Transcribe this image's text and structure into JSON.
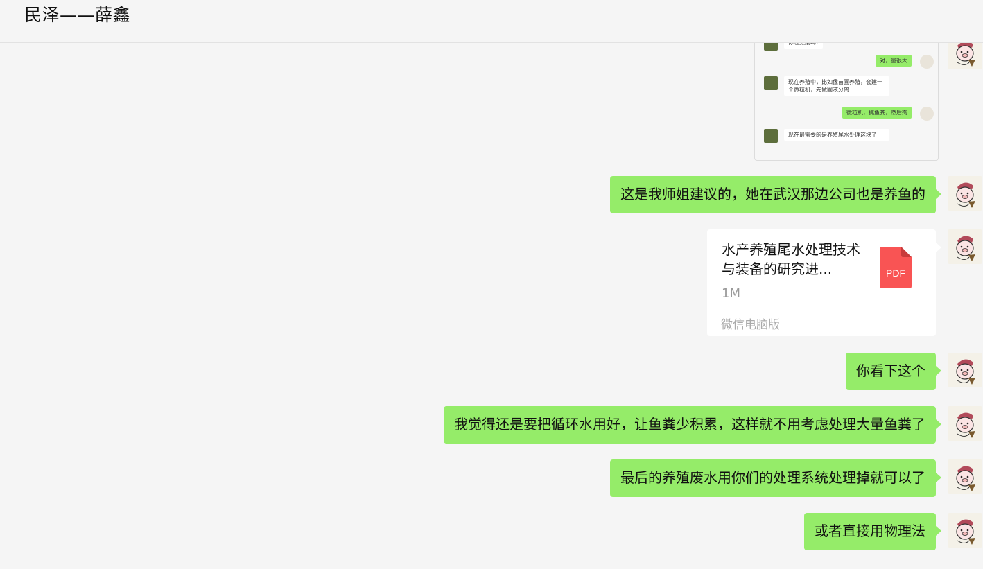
{
  "window": {
    "title": "民泽——薛鑫"
  },
  "forwarded_screenshot": {
    "messages": [
      {
        "side": "left",
        "text": "你也太废吗?"
      },
      {
        "side": "right",
        "text": "对，量很大"
      },
      {
        "side": "left",
        "text": "现在养殖中，比如像苗圃养殖，会建一个微粒机，先做固液分离"
      },
      {
        "side": "right",
        "text": "微粒机，挑鱼粪，然后掏"
      },
      {
        "side": "left",
        "text": "现在最需要的是养殖尾水处理这块了"
      }
    ]
  },
  "messages": [
    {
      "type": "text",
      "text": "这是我师姐建议的，她在武汉那边公司也是养鱼的"
    },
    {
      "type": "file",
      "name": "水产养殖尾水处理技术与装备的研究进...",
      "size": "1M",
      "source": "微信电脑版",
      "icon_label": "PDF",
      "icon_color": "#f95454"
    },
    {
      "type": "text",
      "text": "你看下这个"
    },
    {
      "type": "text",
      "text": "我觉得还是要把循环水用好，让鱼粪少积累，这样就不用考虑处理大量鱼粪了"
    },
    {
      "type": "text",
      "text": "最后的养殖废水用你们的处理系统处理掉就可以了"
    },
    {
      "type": "text",
      "text": "或者直接用物理法"
    }
  ],
  "colors": {
    "bubble_self": "#95ec69",
    "background": "#f5f5f5",
    "file_card": "#ffffff"
  }
}
